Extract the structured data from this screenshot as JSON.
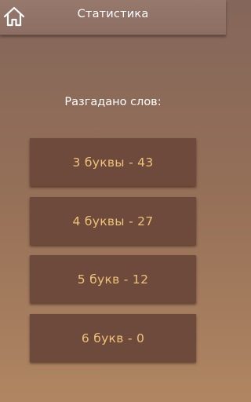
{
  "header": {
    "title": "Статистика",
    "home_icon": "home-icon"
  },
  "main": {
    "heading": "Разгадано слов:",
    "stats": [
      {
        "label": "3 буквы - 43"
      },
      {
        "label": "4 буквы - 27"
      },
      {
        "label": "5 букв - 12"
      },
      {
        "label": "6 букв - 0"
      }
    ]
  },
  "colors": {
    "card_bg": "#6e4a3c",
    "card_text": "#eec276",
    "header_bg": "#8f7166"
  }
}
